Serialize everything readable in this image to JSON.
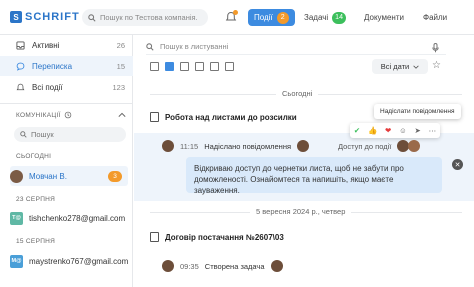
{
  "app": {
    "logo_text": "SCHRIFT",
    "logo_letter": "S"
  },
  "header": {
    "search_placeholder": "Пошук по Тестова компанія.",
    "tabs": [
      {
        "label": "Події",
        "count": "2",
        "active": true
      },
      {
        "label": "Задачі",
        "count": "14",
        "active": false
      },
      {
        "label": "Документи",
        "active": false
      },
      {
        "label": "Файли",
        "active": false
      }
    ]
  },
  "sidebar": {
    "nav": [
      {
        "label": "Активні",
        "count": "26"
      },
      {
        "label": "Переписка",
        "count": "15"
      },
      {
        "label": "Всі події",
        "count": "123"
      }
    ],
    "comms_title": "КОМУНІКАЦІЇ",
    "search_placeholder": "Пошук",
    "today_label": "СЬОГОДНІ",
    "contacts": [
      {
        "section": "СЬОГОДНІ",
        "name": "Мовчан В.",
        "badge": "3",
        "avatar": "photo"
      },
      {
        "section": "23 СЕРПНЯ",
        "name": "tishchenko278@gmail.com",
        "avatar_text": "T@"
      },
      {
        "section": "15 СЕРПНЯ",
        "name": "maystrenko767@gmail.com",
        "avatar_text": "M@"
      }
    ]
  },
  "main": {
    "search_placeholder": "Пошук в листуванні",
    "date_filter": "Всі дати",
    "today_label": "Сьогодні",
    "tooltip": "Надіслати повідомлення",
    "task1": {
      "title": "Робота над листами до розсилки",
      "event_time": "11:15",
      "event_text": "Надіслано повідомлення",
      "access_text": "Доступ до події",
      "message": "Відкриваю доступ до чернетки листа, щоб не забути про доможленості. Ознайомтеся та напишіть, якщо маєте зауваження."
    },
    "date_label2": "5 вересня 2024 р., четвер",
    "task2": {
      "title": "Договір постачання №2607\\03",
      "event_time": "09:35",
      "event_text": "Створена задача"
    },
    "reactions": [
      "✔",
      "👍",
      "❤",
      "☺",
      "➤",
      "⋯"
    ]
  },
  "colors": {
    "accent": "#3d8be0",
    "orange": "#f39a2b",
    "green": "#3cbf5c"
  }
}
